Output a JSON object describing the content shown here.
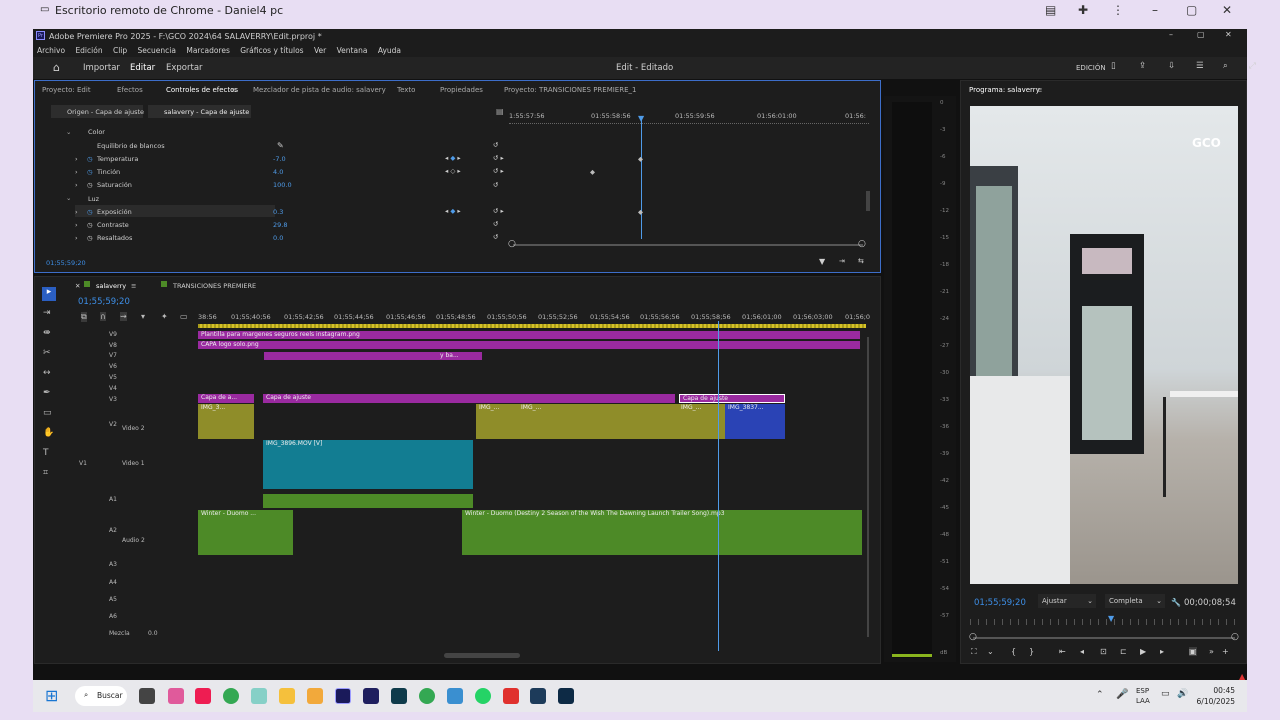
{
  "crd": {
    "title": "Escritorio remoto de Chrome - Daniel4 pc"
  },
  "premiere": {
    "title": "Adobe Premiere Pro 2025 - F:\\GCO 2024\\64 SALAVERRY\\Edit.prproj *",
    "menu": [
      "Archivo",
      "Edición",
      "Clip",
      "Secuencia",
      "Marcadores",
      "Gráficos y títulos",
      "Ver",
      "Ventana",
      "Ayuda"
    ],
    "header": {
      "tabs": [
        "Importar",
        "Editar",
        "Exportar"
      ],
      "center": "Edit - Editado",
      "workspace": "EDICIÓN"
    }
  },
  "effects": {
    "tabs": [
      "Proyecto: Edit",
      "Efectos",
      "Controles de efectos",
      "Mezclador de pista de audio: salavery",
      "Texto",
      "Propiedades",
      "Proyecto: TRANSICIONES PREMIERE_1"
    ],
    "sources": [
      "Origen - Capa de ajuste",
      "salaverry - Capa de ajuste"
    ],
    "rows": [
      {
        "label": "Color",
        "value": ""
      },
      {
        "label": "Equilibrio de blancos",
        "value": ""
      },
      {
        "label": "Temperatura",
        "value": "-7.0"
      },
      {
        "label": "Tinción",
        "value": "4.0"
      },
      {
        "label": "Saturación",
        "value": "100.0"
      },
      {
        "label": "Luz",
        "value": ""
      },
      {
        "label": "Exposición",
        "value": "0.3"
      },
      {
        "label": "Contraste",
        "value": "29.8"
      },
      {
        "label": "Resaltados",
        "value": "0.0"
      }
    ],
    "ruler": [
      "1:55:57:56",
      "01:55:58:56",
      "01:55:59:56",
      "01:56:01:00",
      "01:56:"
    ],
    "timecode": "01;55;59;20"
  },
  "timeline": {
    "tabs": [
      "salaverry",
      "TRANSICIONES PREMIERE"
    ],
    "timecode": "01;55;59;20",
    "ruler": [
      "38:56",
      "01;55;40;56",
      "01;55;42;56",
      "01;55;44;56",
      "01;55;46;56",
      "01;55;48;56",
      "01;55;50;56",
      "01;55;52;56",
      "01;55;54;56",
      "01;55;56;56",
      "01;55;58;56",
      "01;56;01;00",
      "01;56;03;00",
      "01;56;0"
    ],
    "video_tracks": [
      "V9",
      "V8",
      "V7",
      "V6",
      "V5",
      "V4",
      "V3",
      "V2",
      "V1"
    ],
    "audio_tracks": [
      "A1",
      "A2",
      "A3",
      "A4",
      "A5",
      "A6"
    ],
    "video2_label": "Video 2",
    "video1_label": "Video 1",
    "audio2_label": "Audio 2",
    "mix_label": "Mezcla",
    "mix_value": "0.0",
    "clips": {
      "v9": "Plantilla para margenes seguros reels instagram.png",
      "v8": "CAPA logo solo.png",
      "v7_text": "y ba...",
      "v3a": "Capa de a...",
      "v3b": "Capa de ajuste",
      "v3c": "Capa de ajuste",
      "v2a": "IMG_3...",
      "v2b": "IMG_...",
      "v2c": "IMG_...",
      "v2d": "IMG_...",
      "v2e": "IMG_3837...",
      "v1": "IMG_3896.MOV [V]",
      "a2a": "Winter - Duomo ...",
      "a2b": "Winter - Duomo (Destiny 2 Season of the Wish The Dawning Launch Trailer Song).mp3",
      "fx": "fx"
    }
  },
  "vu_scale": [
    "0",
    "-3",
    "-6",
    "-9",
    "-12",
    "-15",
    "-18",
    "-21",
    "-24",
    "-27",
    "-30",
    "-33",
    "-36",
    "-39",
    "-42",
    "-45",
    "-48",
    "-51",
    "-54",
    "-57",
    "dB"
  ],
  "program": {
    "title": "Programa: salaverry",
    "logo": "GCO",
    "timecode": "01;55;59;20",
    "fit": "Ajustar",
    "quality": "Completa",
    "duration": "00;00;08;54"
  },
  "taskbar": {
    "search": "Buscar",
    "lang1": "ESP",
    "lang2": "LAA",
    "time": "00:45",
    "date": "6/10/2025"
  }
}
